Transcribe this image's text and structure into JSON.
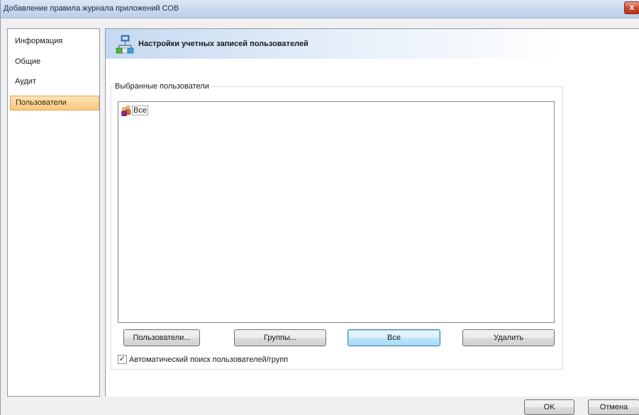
{
  "window": {
    "title": "Добавление правила журнала приложений СОВ",
    "close_glyph": "x"
  },
  "sidebar": {
    "items": [
      {
        "label": "Информация",
        "active": false
      },
      {
        "label": "Общие",
        "active": false
      },
      {
        "label": "Аудит",
        "active": false
      },
      {
        "label": "Пользователи",
        "active": true
      }
    ]
  },
  "header": {
    "title": "Настройки учетных записей пользователей",
    "icon": "user-accounts-network-icon"
  },
  "selected_users": {
    "group_label": "Выбранные пользователи",
    "items": [
      {
        "label": "Все",
        "icon": "users-group-icon"
      }
    ]
  },
  "actions": {
    "users_label": "Пользователи...",
    "groups_label": "Группы...",
    "all_label": "Все",
    "delete_label": "Удалить"
  },
  "auto_search": {
    "label": "Автоматический поиск пользователей/групп",
    "checked": true
  },
  "footer": {
    "ok_label": "OK",
    "cancel_label": "Отмена"
  },
  "colors": {
    "active_nav": "#f9c780",
    "header_gradient": "#c6d9f1",
    "close_button": "#c9452b"
  }
}
